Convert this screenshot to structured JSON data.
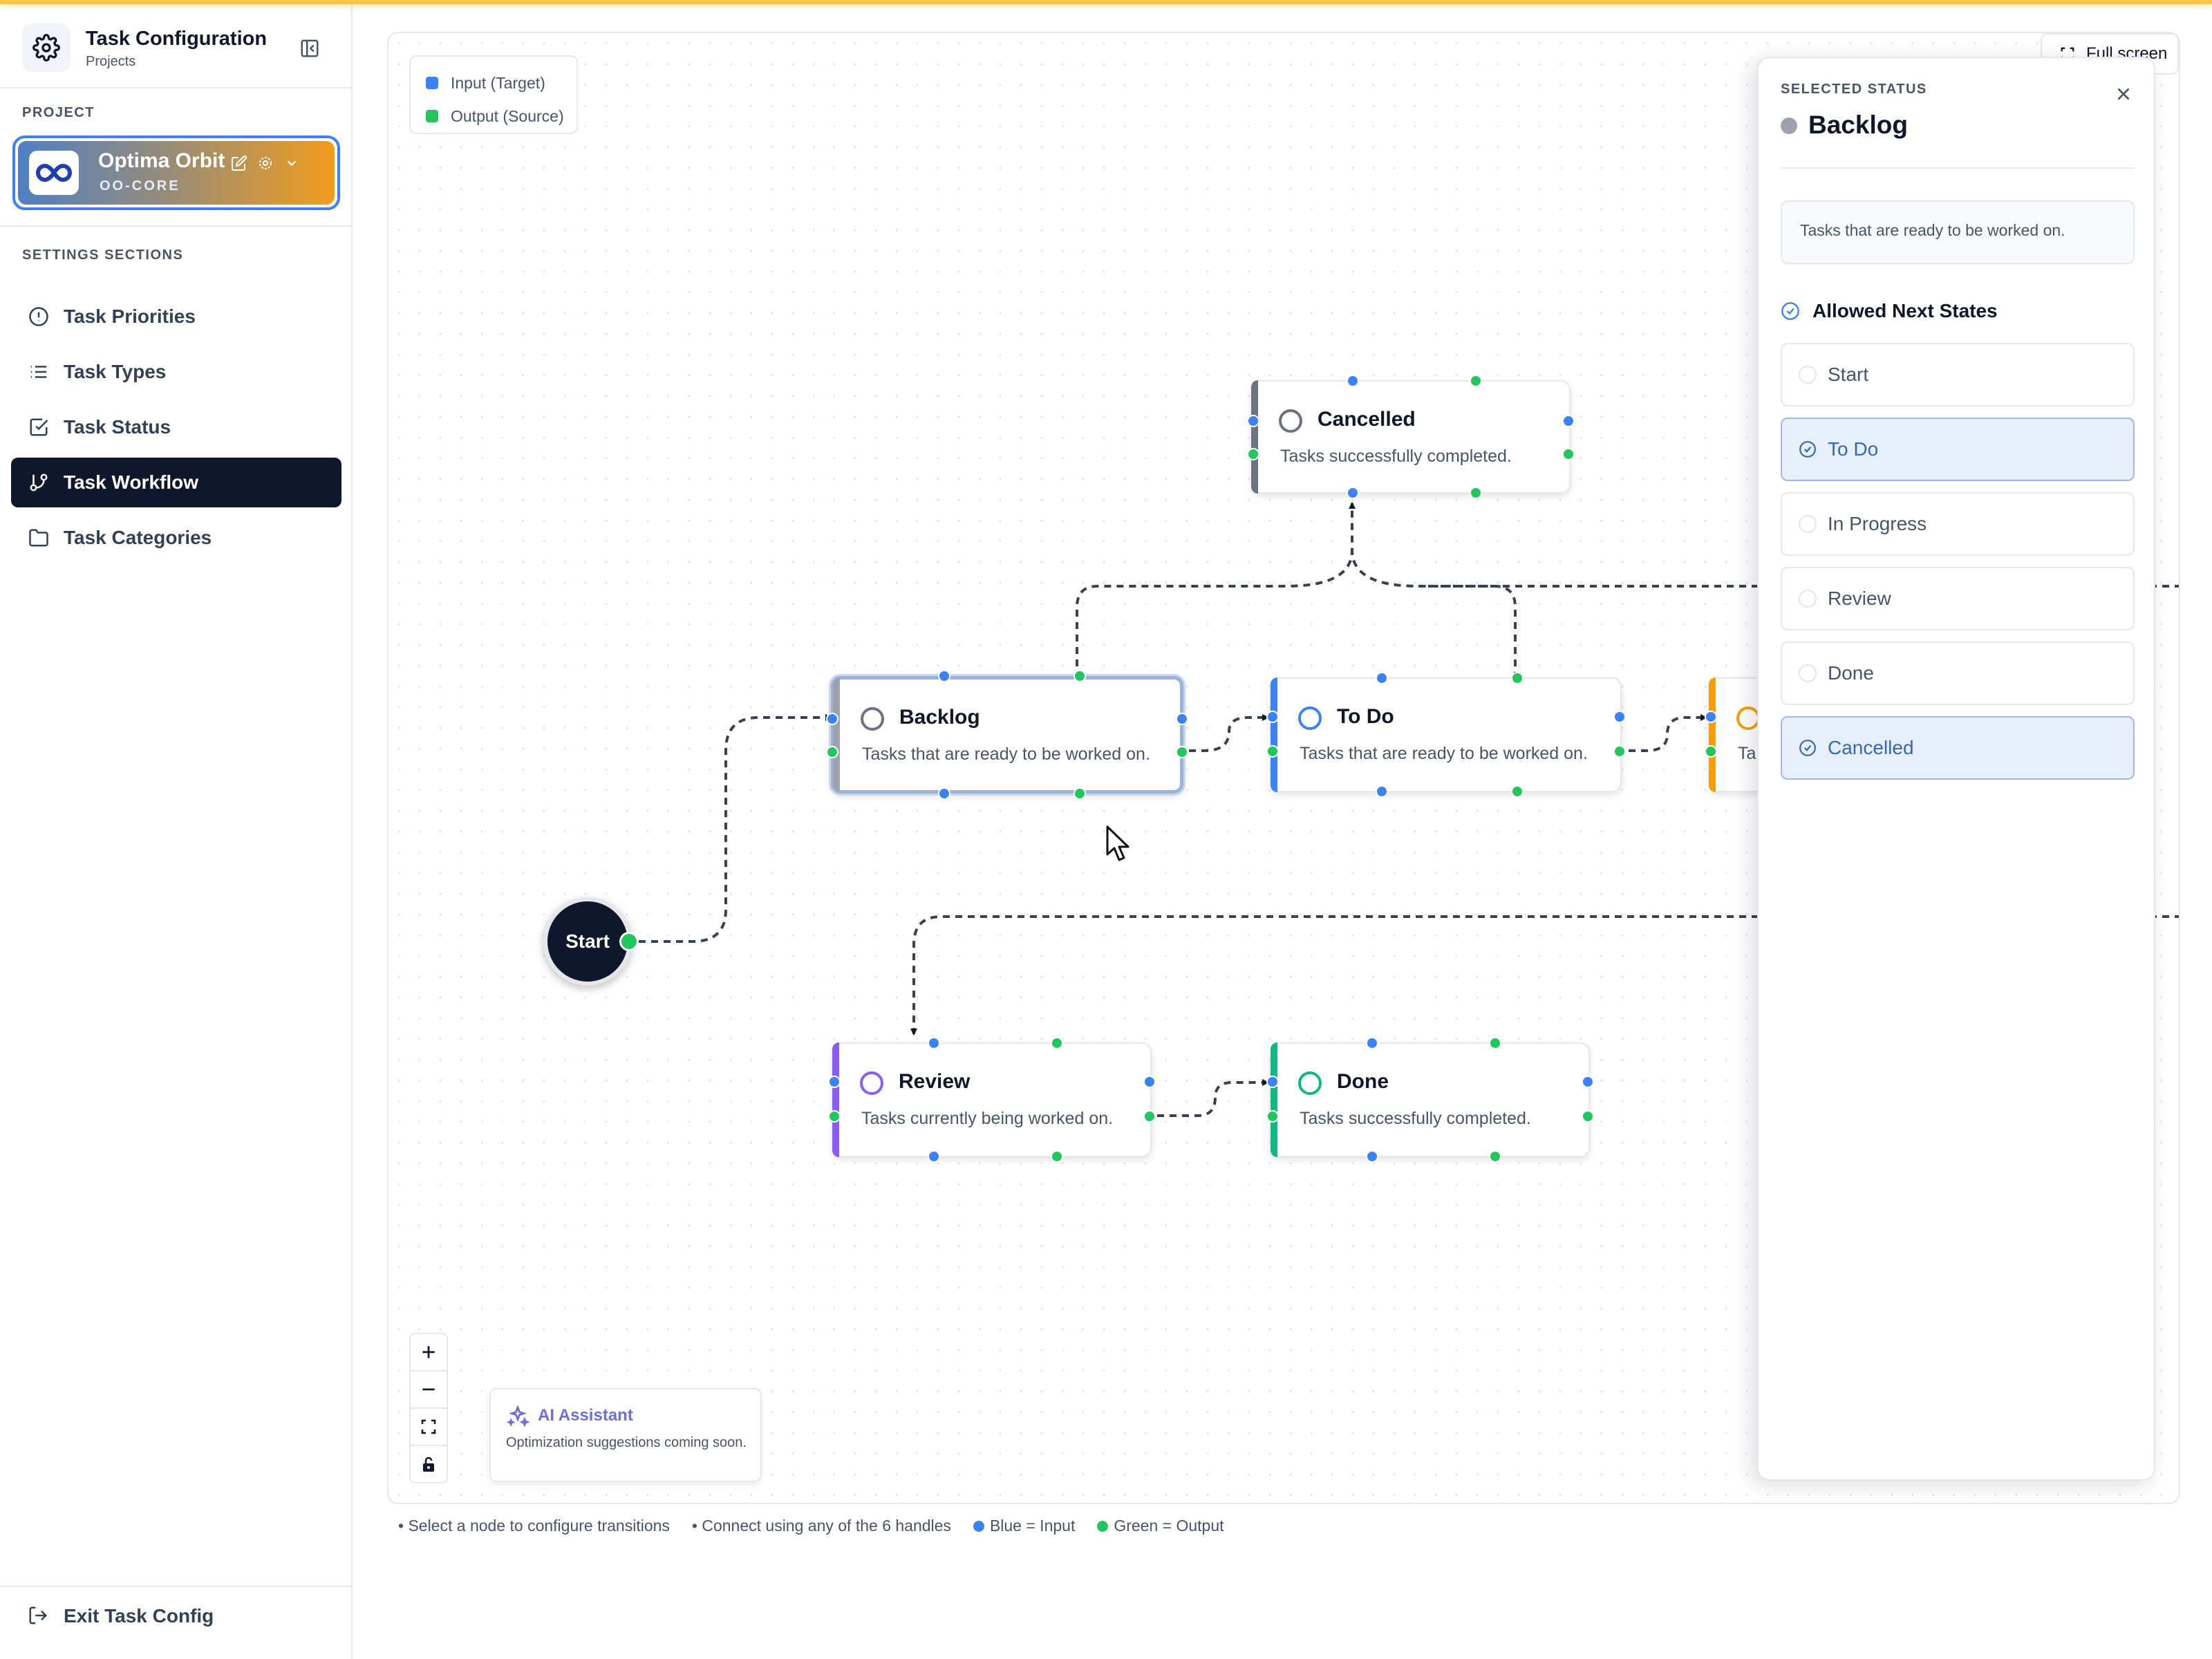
{
  "app": {
    "title": "Task Configuration",
    "subtitle": "Projects"
  },
  "sidebar": {
    "project_label": "PROJECT",
    "project": {
      "name": "Optima Orbit",
      "code": "OO-CORE"
    },
    "sections_label": "SETTINGS SECTIONS",
    "items": [
      {
        "label": "Task Priorities",
        "icon": "alert-circle-icon"
      },
      {
        "label": "Task Types",
        "icon": "list-icon"
      },
      {
        "label": "Task Status",
        "icon": "check-square-icon"
      },
      {
        "label": "Task Workflow",
        "icon": "git-branch-icon",
        "active": true
      },
      {
        "label": "Task Categories",
        "icon": "folder-icon"
      }
    ],
    "exit_label": "Exit Task Config"
  },
  "canvas": {
    "legend": {
      "input": "Input (Target)",
      "output": "Output (Source)"
    },
    "fullscreen_label": "Full screen",
    "start_label": "Start",
    "nodes": [
      {
        "id": "cancelled",
        "title": "Cancelled",
        "desc": "Tasks successfully completed.",
        "color": "#6b7280"
      },
      {
        "id": "backlog",
        "title": "Backlog",
        "desc": "Tasks that are ready to be worked on.",
        "color": "#9ca3af",
        "selected": true
      },
      {
        "id": "todo",
        "title": "To Do",
        "desc": "Tasks that are ready to be worked on.",
        "color": "#3b82f6"
      },
      {
        "id": "inprogress",
        "title": "",
        "desc": "Ta",
        "color": "#f59e0b"
      },
      {
        "id": "review",
        "title": "Review",
        "desc": "Tasks currently being worked on.",
        "color": "#8b5cf6"
      },
      {
        "id": "done",
        "title": "Done",
        "desc": "Tasks successfully completed.",
        "color": "#10b981"
      }
    ],
    "ai": {
      "title": "AI Assistant",
      "desc": "Optimization suggestions coming soon."
    }
  },
  "panel": {
    "label": "SELECTED STATUS",
    "name": "Backlog",
    "description": "Tasks that are ready to be worked on.",
    "allowed_label": "Allowed Next States",
    "states": [
      {
        "label": "Start",
        "selected": false
      },
      {
        "label": "To Do",
        "selected": true
      },
      {
        "label": "In Progress",
        "selected": false
      },
      {
        "label": "Review",
        "selected": false
      },
      {
        "label": "Done",
        "selected": false
      },
      {
        "label": "Cancelled",
        "selected": true
      }
    ]
  },
  "help": {
    "tip1": "• Select a node to configure transitions",
    "tip2": "• Connect using any of the 6 handles",
    "blue": "Blue = Input",
    "green": "Green = Output"
  },
  "colors": {
    "input": "#3b82f6",
    "output": "#22c55e",
    "active_nav": "#0f172a",
    "accent": "#3567b4"
  }
}
